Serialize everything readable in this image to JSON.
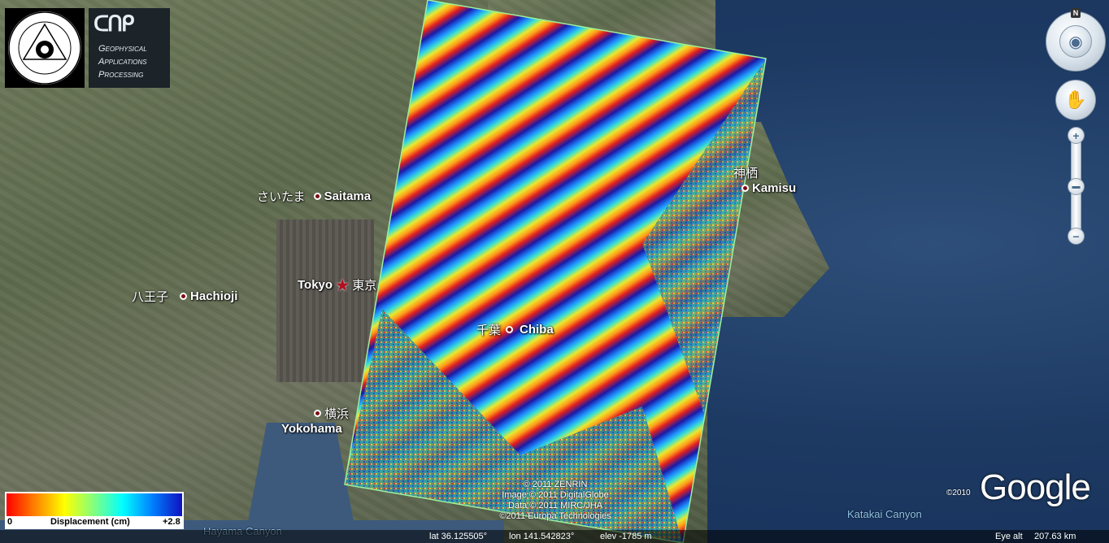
{
  "app": "Google Earth",
  "logos": {
    "poli_name": "POLITECNICO DI BARI",
    "poli_motto": "de remi facemmo ali",
    "gap_line1": "Geophysical",
    "gap_line2": "Applications",
    "gap_line3": "Processing"
  },
  "cities": [
    {
      "id": "saitama",
      "jp": "さいたま",
      "en": "Saitama",
      "marker": "dot"
    },
    {
      "id": "tokyo",
      "jp": "東京",
      "en": "Tokyo",
      "marker": "star"
    },
    {
      "id": "hachioji",
      "jp": "八王子",
      "en": "Hachioji",
      "marker": "dot"
    },
    {
      "id": "chiba",
      "jp": "千葉",
      "en": "Chiba",
      "marker": "dot"
    },
    {
      "id": "yokohama",
      "jp": "横浜",
      "en": "Yokohama",
      "marker": "dot"
    },
    {
      "id": "kamisu",
      "jp": "神栖",
      "en": "Kamisu",
      "marker": "dot"
    }
  ],
  "places": {
    "katakai": "Katakai Canyon",
    "hayama": "Hayama Canyon"
  },
  "copyright": {
    "line1": "© 2011 ZENRIN",
    "line2": "Image © 2011 DigitalGlobe",
    "line3": "Data © 2011 MIRC/JHA",
    "line4": "©2011 Europa Technologies"
  },
  "legend": {
    "min": "0",
    "title": "Displacement (cm)",
    "max": "+2.8",
    "colors": [
      "#ff0000",
      "#ff8000",
      "#ffff00",
      "#80ff80",
      "#00ffff",
      "#0080ff",
      "#1010c0"
    ]
  },
  "google": {
    "year": "©2010",
    "wordmark": "Google"
  },
  "nav": {
    "north": "N",
    "zoom_in": "+",
    "zoom_out": "−"
  },
  "status": {
    "lat": "lat  36.125505°",
    "lon": "lon  141.542823°",
    "elev": "elev  -1785 m",
    "eye_label": "Eye alt",
    "eye_value": "207.63 km"
  }
}
